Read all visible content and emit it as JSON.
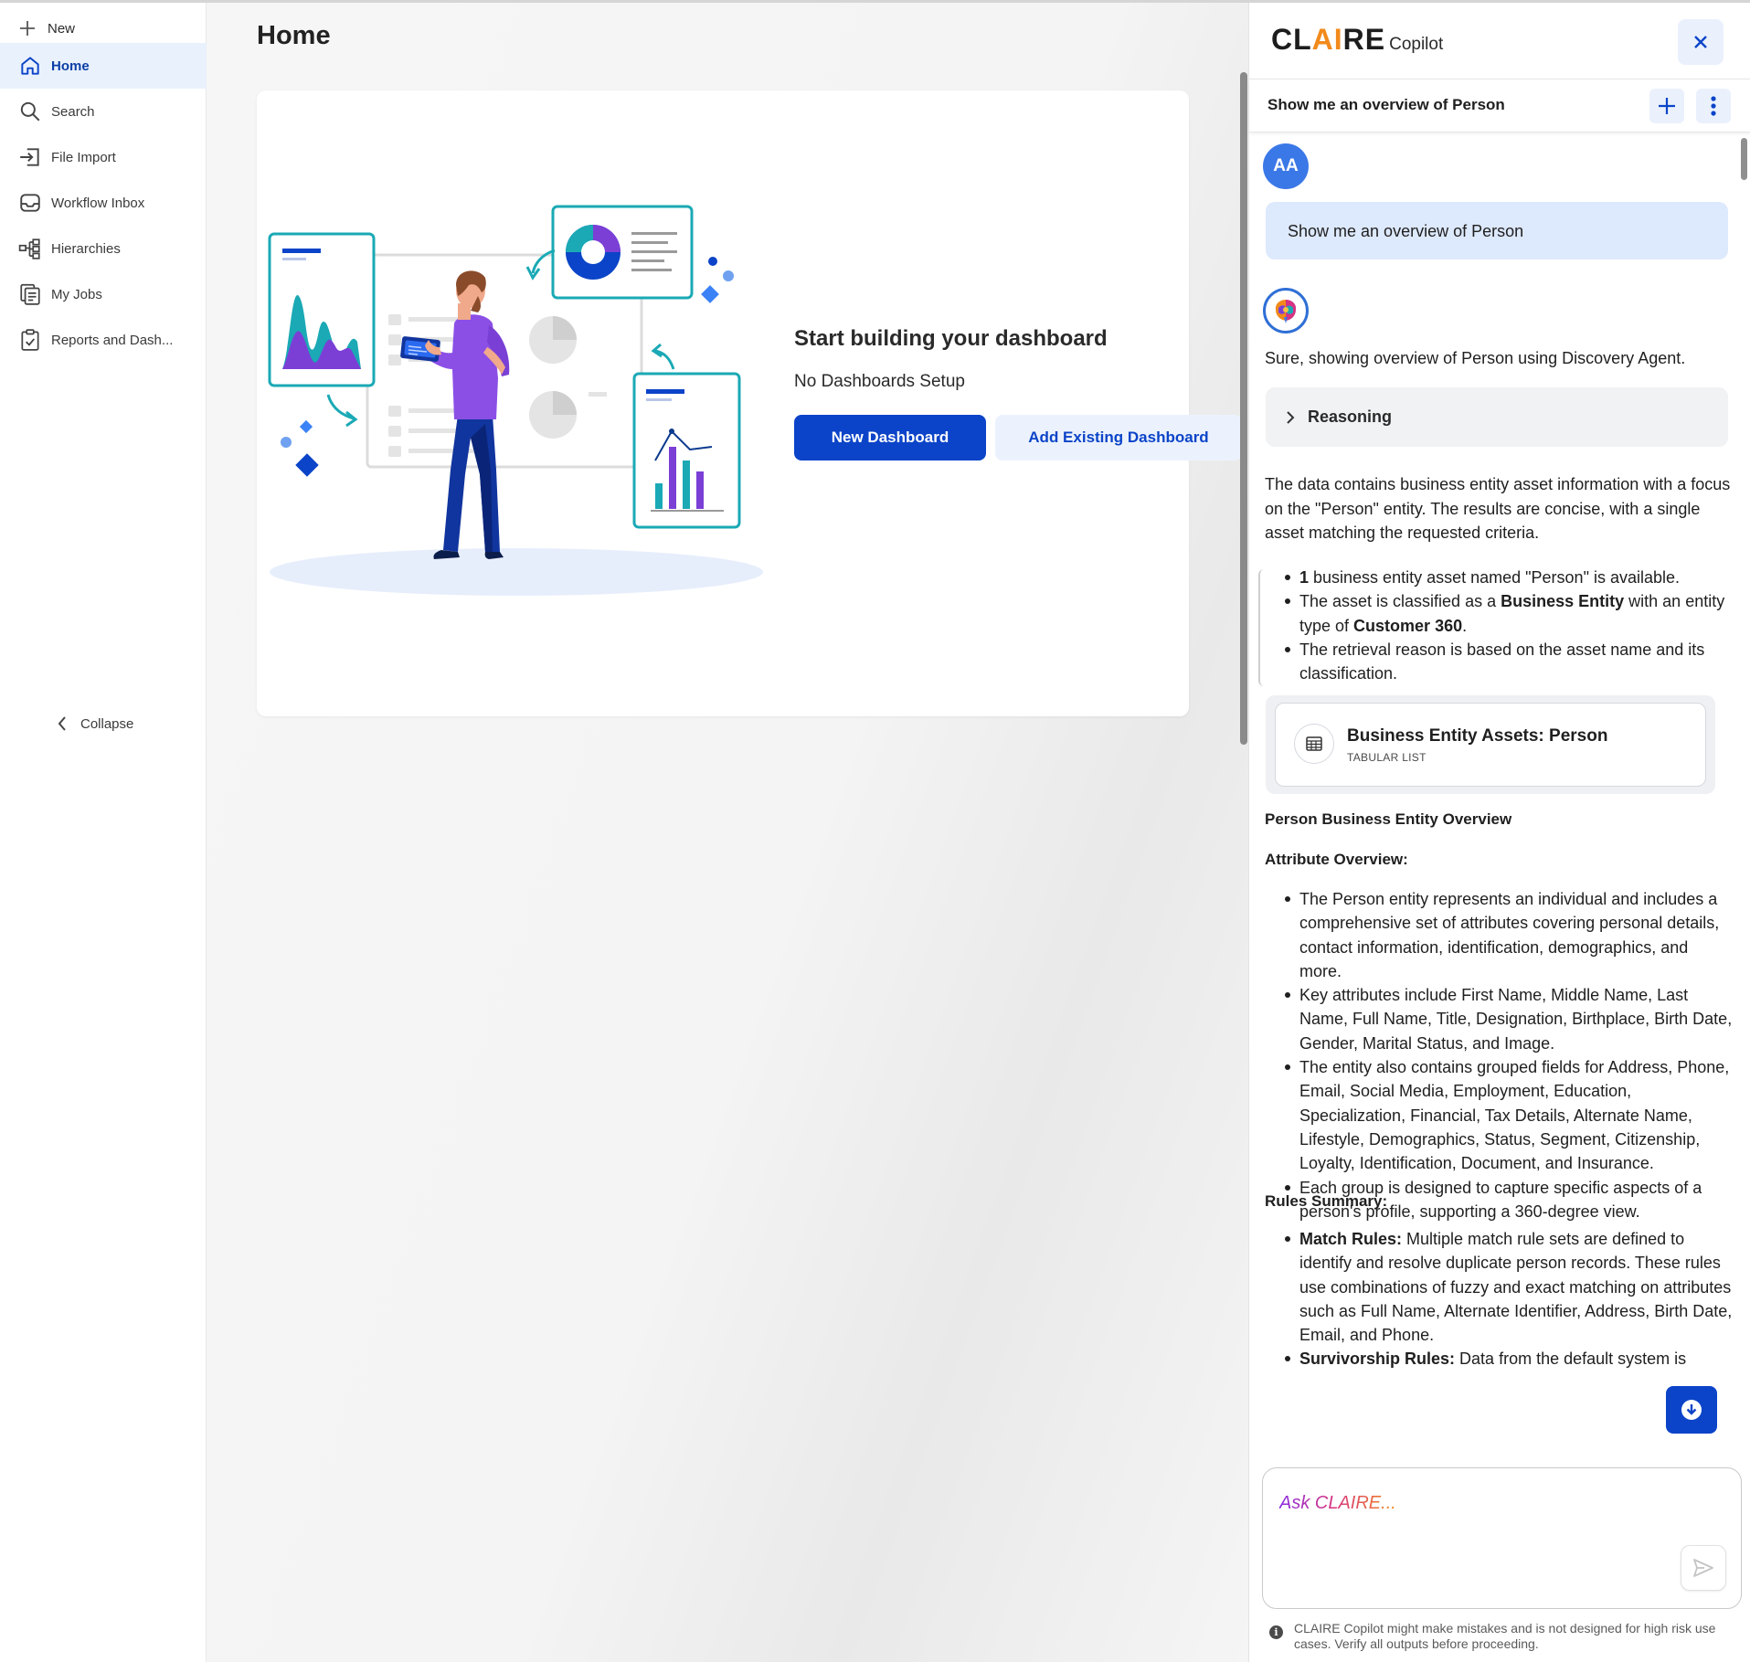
{
  "sidebar": {
    "new_label": "New",
    "items": [
      {
        "label": "Home",
        "icon": "home-icon",
        "active": true
      },
      {
        "label": "Search",
        "icon": "search-icon"
      },
      {
        "label": "File Import",
        "icon": "file-import-icon"
      },
      {
        "label": "Workflow Inbox",
        "icon": "inbox-icon"
      },
      {
        "label": "Hierarchies",
        "icon": "hierarchy-icon"
      },
      {
        "label": "My Jobs",
        "icon": "jobs-icon"
      },
      {
        "label": "Reports and Dash..."
      }
    ],
    "collapse_label": "Collapse"
  },
  "main": {
    "title": "Home",
    "empty_state": {
      "title": "Start building your dashboard",
      "subtitle": "No Dashboards Setup",
      "primary_button": "New Dashboard",
      "secondary_button": "Add Existing Dashboard"
    }
  },
  "copilot": {
    "brand_main": "CLAIRE",
    "brand_sub": "Copilot",
    "conversation_title": "Show me an overview of Person",
    "user_initials": "AA",
    "user_message": "Show me an overview of Person",
    "ai_intro": "Sure, showing overview of Person using Discovery Agent.",
    "reasoning_label": "Reasoning",
    "summary_paragraph": "The data contains business entity asset information with a focus on the \"Person\" entity. The results are concise, with a single asset matching the requested criteria.",
    "summary_bullets": [
      {
        "bold": "1",
        "text": " business entity asset named \"Person\" is available."
      },
      {
        "pre": "The asset is classified as a ",
        "bold": "Business Entity",
        "mid": " with an entity type of ",
        "bold2": "Customer 360",
        "post": "."
      },
      {
        "text": "The retrieval reason is based on the asset name and its classification."
      }
    ],
    "artifact": {
      "title": "Business Entity Assets: Person",
      "subtitle": "TABULAR LIST",
      "icon": "table-icon"
    },
    "overview_heading": "Person Business Entity Overview",
    "attribute_heading": "Attribute Overview:",
    "attribute_bullets": [
      "The Person entity represents an individual and includes a comprehensive set of attributes covering personal details, contact information, identification, demographics, and more.",
      "Key attributes include First Name, Middle Name, Last Name, Full Name, Title, Designation, Birthplace, Birth Date, Gender, Marital Status, and Image.",
      "The entity also contains grouped fields for Address, Phone, Email, Social Media, Employment, Education, Specialization, Financial, Tax Details, Alternate Name, Lifestyle, Demographics, Status, Segment, Citizenship, Loyalty, Identification, Document, and Insurance.",
      "Each group is designed to capture specific aspects of a person's profile, supporting a 360-degree view."
    ],
    "rules_heading": "Rules Summary:",
    "rules_bullets": [
      {
        "bold": "Match Rules:",
        "text": " Multiple match rule sets are defined to identify and resolve duplicate person records. These rules use combinations of fuzzy and exact matching on attributes such as Full Name, Alternate Identifier, Address, Birth Date, Email, and Phone."
      },
      {
        "bold": "Survivorship Rules:",
        "text": " Data from the default system is"
      }
    ],
    "input_placeholder": "Ask CLAIRE...",
    "disclaimer": "CLAIRE Copilot might make mistakes and is not designed for high risk use cases. Verify all outputs before proceeding."
  },
  "colors": {
    "accent": "#0b44c8",
    "active_nav_bg": "#e9f1fc",
    "user_bubble": "#dde9fc",
    "brand_orange": "#f28a1b",
    "teal": "#1aa9b5",
    "purple": "#7b3fd6"
  }
}
